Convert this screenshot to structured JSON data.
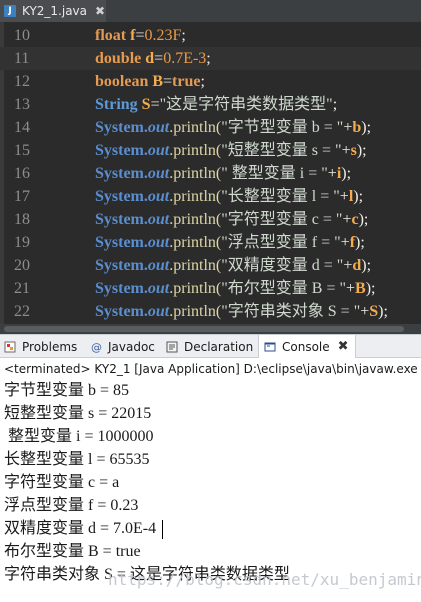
{
  "editor": {
    "tab": {
      "title": "KY2_1.java",
      "close": "✖",
      "icon": "java-file-icon"
    },
    "lines": [
      {
        "num": "10",
        "tokens": [
          [
            "kw",
            "float "
          ],
          [
            "id",
            "f"
          ],
          [
            "pun",
            "="
          ],
          [
            "num",
            "0.23F"
          ],
          [
            "pun",
            ";"
          ]
        ]
      },
      {
        "num": "11",
        "tokens": [
          [
            "kw",
            "double "
          ],
          [
            "id",
            "d"
          ],
          [
            "pun",
            "="
          ],
          [
            "num",
            "0.7E-3"
          ],
          [
            "pun",
            ";"
          ]
        ]
      },
      {
        "num": "12",
        "tokens": [
          [
            "kw",
            "boolean "
          ],
          [
            "id",
            "B"
          ],
          [
            "pun",
            "="
          ],
          [
            "kw",
            "true"
          ],
          [
            "pun",
            ";"
          ]
        ]
      },
      {
        "num": "13",
        "tokens": [
          [
            "ty",
            "String "
          ],
          [
            "id",
            "S"
          ],
          [
            "pun",
            "="
          ],
          [
            "str",
            "\"这是字符串类数据类型\""
          ],
          [
            "pun",
            ";"
          ]
        ]
      },
      {
        "num": "14",
        "tokens": [
          [
            "sys",
            "System."
          ],
          [
            "out",
            "out"
          ],
          [
            "mth",
            ".println("
          ],
          [
            "str",
            "\"字节型变量 b = \""
          ],
          [
            "pun",
            "+"
          ],
          [
            "id",
            "b"
          ],
          [
            "pun",
            ");"
          ]
        ]
      },
      {
        "num": "15",
        "tokens": [
          [
            "sys",
            "System."
          ],
          [
            "out",
            "out"
          ],
          [
            "mth",
            ".println("
          ],
          [
            "str",
            "\"短整型变量 s = \""
          ],
          [
            "pun",
            "+"
          ],
          [
            "id",
            "s"
          ],
          [
            "pun",
            ");"
          ]
        ]
      },
      {
        "num": "16",
        "tokens": [
          [
            "sys",
            "System."
          ],
          [
            "out",
            "out"
          ],
          [
            "mth",
            ".println("
          ],
          [
            "str",
            "\" 整型变量 i = \""
          ],
          [
            "pun",
            "+"
          ],
          [
            "id",
            "i"
          ],
          [
            "pun",
            ");"
          ]
        ]
      },
      {
        "num": "17",
        "tokens": [
          [
            "sys",
            "System."
          ],
          [
            "out",
            "out"
          ],
          [
            "mth",
            ".println("
          ],
          [
            "str",
            "\"长整型变量 l = \""
          ],
          [
            "pun",
            "+"
          ],
          [
            "id",
            "l"
          ],
          [
            "pun",
            ");"
          ]
        ]
      },
      {
        "num": "18",
        "tokens": [
          [
            "sys",
            "System."
          ],
          [
            "out",
            "out"
          ],
          [
            "mth",
            ".println("
          ],
          [
            "str",
            "\"字符型变量 c = \""
          ],
          [
            "pun",
            "+"
          ],
          [
            "id",
            "c"
          ],
          [
            "pun",
            ");"
          ]
        ]
      },
      {
        "num": "19",
        "tokens": [
          [
            "sys",
            "System."
          ],
          [
            "out",
            "out"
          ],
          [
            "mth",
            ".println("
          ],
          [
            "str",
            "\"浮点型变量 f = \""
          ],
          [
            "pun",
            "+"
          ],
          [
            "id",
            "f"
          ],
          [
            "pun",
            ");"
          ]
        ]
      },
      {
        "num": "20",
        "tokens": [
          [
            "sys",
            "System."
          ],
          [
            "out",
            "out"
          ],
          [
            "mth",
            ".println("
          ],
          [
            "str",
            "\"双精度变量 d = \""
          ],
          [
            "pun",
            "+"
          ],
          [
            "id",
            "d"
          ],
          [
            "pun",
            ");"
          ]
        ]
      },
      {
        "num": "21",
        "tokens": [
          [
            "sys",
            "System."
          ],
          [
            "out",
            "out"
          ],
          [
            "mth",
            ".println("
          ],
          [
            "str",
            "\"布尔型变量 B = \""
          ],
          [
            "pun",
            "+"
          ],
          [
            "id",
            "B"
          ],
          [
            "pun",
            ");"
          ]
        ]
      },
      {
        "num": "22",
        "tokens": [
          [
            "sys",
            "System."
          ],
          [
            "out",
            "out"
          ],
          [
            "mth",
            ".println("
          ],
          [
            "str",
            "\"字符串类对象 S = \""
          ],
          [
            "pun",
            "+"
          ],
          [
            "id",
            "S"
          ],
          [
            "pun",
            ");"
          ]
        ]
      }
    ],
    "highlight_line": "11"
  },
  "panel": {
    "tabs": [
      {
        "label": "Problems",
        "icon": "problems-icon"
      },
      {
        "label": "Javadoc",
        "icon": "javadoc-icon"
      },
      {
        "label": "Declaration",
        "icon": "declaration-icon"
      },
      {
        "label": "Console",
        "icon": "console-icon",
        "active": true,
        "close": "✖"
      }
    ],
    "status": "<terminated> KY2_1 [Java Application] D:\\eclipse\\java\\bin\\javaw.exe (20"
  },
  "console": {
    "lines": [
      "字节型变量 b = 85",
      "短整型变量 s = 22015",
      " 整型变量 i = 1000000",
      "长整型变量 l = 65535",
      "字符型变量 c = a",
      "浮点型变量 f = 0.23",
      "双精度变量 d = 7.0E-4",
      "布尔型变量 B = true",
      "字符串类对象 S = 这是字符串类数据类型"
    ]
  },
  "watermark": "https://blog.csdn.net/xu_benjamin",
  "colors": {
    "editor_bg": "#2b2b2b",
    "keyword": "#e49a50",
    "type": "#5f9ad6",
    "console_bg": "#ffffff"
  }
}
